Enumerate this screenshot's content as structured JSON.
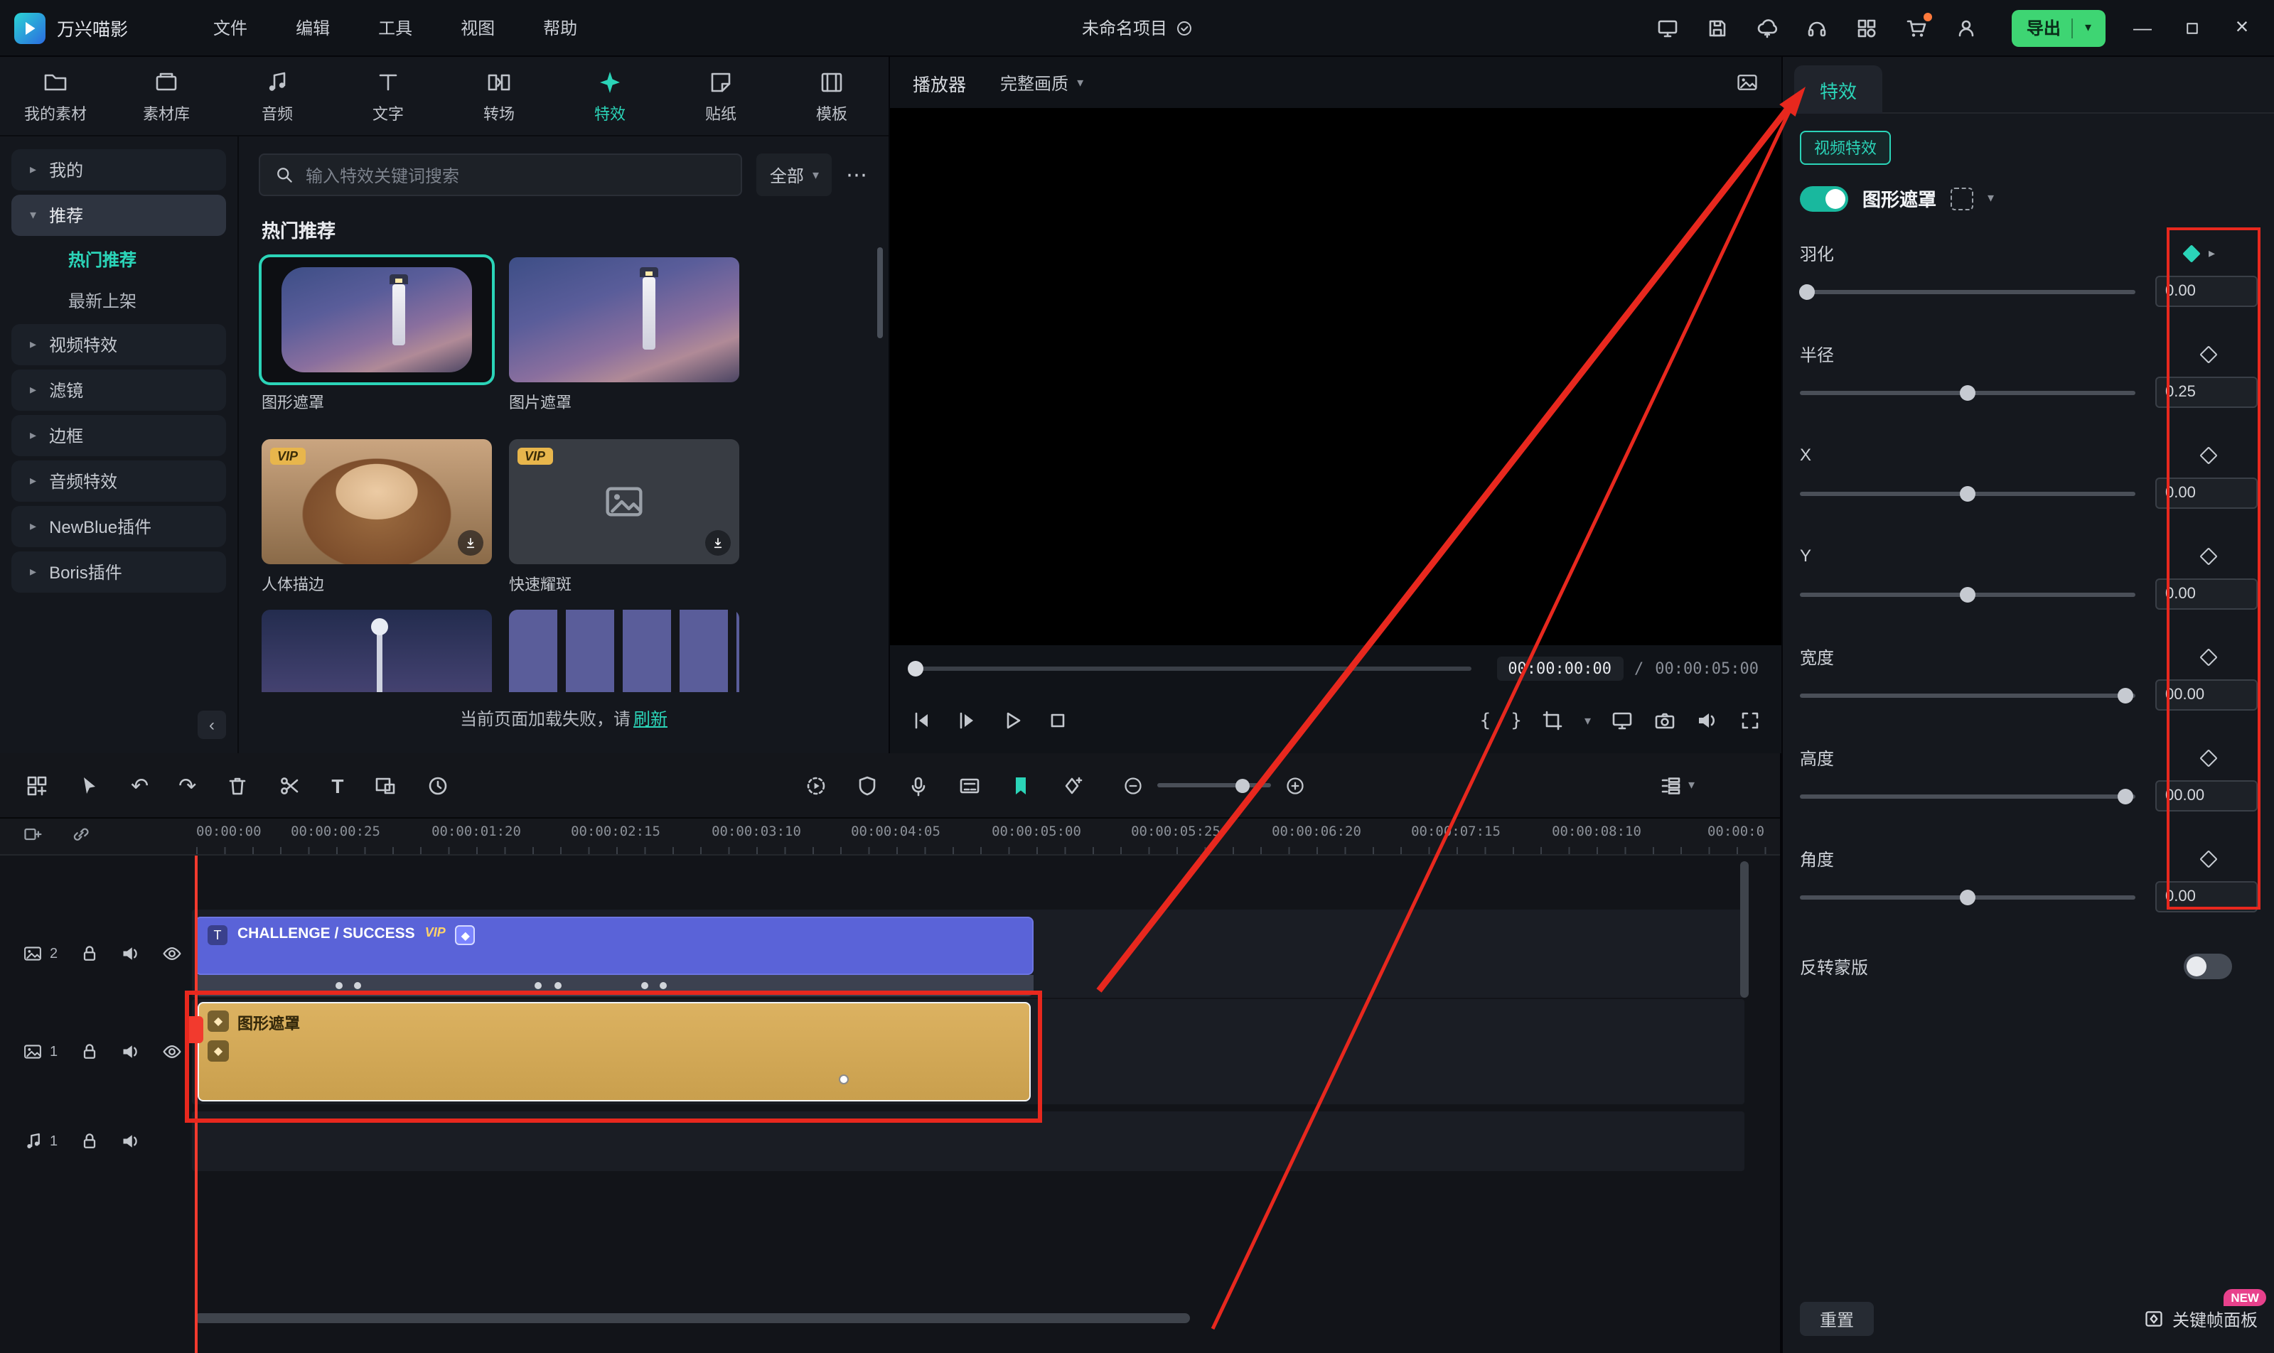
{
  "ui": {
    "chevron_down": "▾",
    "chevron_right": "▸",
    "collapse_left": "‹",
    "more": "⋯",
    "undo": "↶",
    "redo": "↷",
    "minimize": "—",
    "close": "×",
    "diamond": "◆"
  },
  "colors": {
    "accent": "#2bd4b8",
    "export_green": "#3ed573",
    "clip_blue": "#5a63d8",
    "clip_gold": "#d4a852",
    "annotation_red": "#e8281e",
    "vip_gold": "#e8b64c",
    "new_pink": "#e8418c"
  },
  "topbar": {
    "app_name": "万兴喵影",
    "menus": [
      "文件",
      "编辑",
      "工具",
      "视图",
      "帮助"
    ],
    "project_title": "未命名项目",
    "export_label": "导出"
  },
  "media_panel": {
    "tabs": [
      {
        "label": "我的素材"
      },
      {
        "label": "素材库"
      },
      {
        "label": "音频"
      },
      {
        "label": "文字"
      },
      {
        "label": "转场"
      },
      {
        "label": "特效"
      },
      {
        "label": "贴纸"
      },
      {
        "label": "模板"
      }
    ],
    "sidebar": {
      "groups": [
        {
          "label": "我的"
        },
        {
          "label": "推荐"
        },
        {
          "label": "视频特效"
        },
        {
          "label": "滤镜"
        },
        {
          "label": "边框"
        },
        {
          "label": "音频特效"
        },
        {
          "label": "NewBlue插件"
        },
        {
          "label": "Boris插件"
        }
      ],
      "children": [
        {
          "label": "热门推荐"
        },
        {
          "label": "最新上架"
        }
      ]
    },
    "search": {
      "placeholder": "输入特效关键词搜索"
    },
    "filter": {
      "label": "全部"
    },
    "section_title": "热门推荐",
    "effects": [
      {
        "name": "图形遮罩"
      },
      {
        "name": "图片遮罩"
      },
      {
        "name": "人体描边",
        "badge": "VIP"
      },
      {
        "name": "快速耀斑",
        "badge": "VIP"
      }
    ],
    "error": {
      "text": "当前页面加载失败，请",
      "link": "刷新"
    }
  },
  "player": {
    "title": "播放器",
    "quality": "完整画质",
    "current_time": "00:00:00:00",
    "separator": "/",
    "duration": "00:00:05:00",
    "mark_in": "{",
    "mark_out": "}"
  },
  "properties": {
    "tab": "特效",
    "badge": "视频特效",
    "effect_name": "图形遮罩",
    "params": [
      {
        "label": "羽化",
        "value": "0.00",
        "slider_left": "2%"
      },
      {
        "label": "半径",
        "value": "0.25",
        "slider_left": "50%"
      },
      {
        "label": "X",
        "value": "0.00",
        "slider_left": "50%"
      },
      {
        "label": "Y",
        "value": "0.00",
        "slider_left": "50%"
      },
      {
        "label": "宽度",
        "value": "00.00",
        "slider_left": "97%"
      },
      {
        "label": "高度",
        "value": "00.00",
        "slider_left": "97%"
      },
      {
        "label": "角度",
        "value": "0.00",
        "slider_left": "50%"
      }
    ],
    "invert_label": "反转蒙版",
    "reset_label": "重置",
    "keyframe_panel_label": "关键帧面板",
    "new_badge": "NEW"
  },
  "timeline": {
    "ruler": [
      "00:00:00",
      "00:00:00:25",
      "00:00:01:20",
      "00:00:02:15",
      "00:00:03:10",
      "00:00:04:05",
      "00:00:05:00",
      "00:00:05:25",
      "00:00:06:20",
      "00:00:07:15",
      "00:00:08:10",
      "00:00:0"
    ],
    "tracks": {
      "video2_label": "2",
      "video1_label": "1",
      "audio1_label": "1"
    },
    "clips": {
      "text_title": "CHALLENGE / SUCCESS",
      "text_badge": "VIP",
      "effect_title": "图形遮罩"
    }
  }
}
